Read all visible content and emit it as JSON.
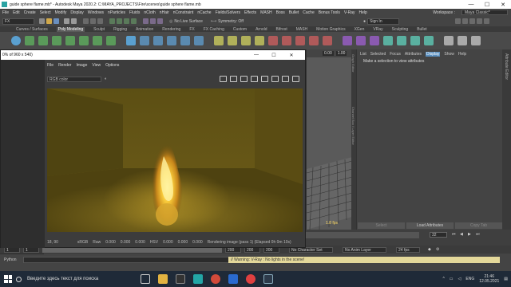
{
  "app": {
    "title": "guide sphere flame.mb* - Autodesk Maya 2020.2: C:\\MAYA_PROJECTS\\Fire\\scenes\\guide sphere flame.mb",
    "window_controls": [
      "—",
      "☐",
      "✕"
    ]
  },
  "menubar": {
    "items": [
      "File",
      "Edit",
      "Create",
      "Select",
      "Modify",
      "Display",
      "Windows",
      "nParticles",
      "Fluids",
      "nCloth",
      "nHair",
      "nConstraint",
      "nCache",
      "Fields/Solvers",
      "Effects",
      "MASH",
      "Boss",
      "Bullet",
      "Cache",
      "Bonus Tools",
      "V-Ray",
      "Help"
    ],
    "workspace_label": "Workspace :",
    "workspace_value": "Maya Classic*"
  },
  "toolbar": {
    "menuset": "FX",
    "no_live_surface": "No Live Surface",
    "symmetry": "Symmetry: Off",
    "sign_in": "Sign In"
  },
  "shelf_tabs": {
    "items": [
      "Curves / Surfaces",
      "Poly Modeling",
      "Sculpt",
      "Rigging",
      "Animation",
      "Rendering",
      "FX",
      "FX Caching",
      "Custom",
      "Arnold",
      "Bifrost",
      "MASH",
      "Motion Graphics",
      "XGen",
      "VRay",
      "Sculpting",
      "Bullet"
    ],
    "active_index": 1
  },
  "render_window": {
    "title": "0% of 960 x 540)",
    "menu": [
      "File",
      "Render",
      "Image",
      "View",
      "Options"
    ],
    "channel": "RGB color",
    "status_coords": "18, 90",
    "status_items": [
      "sRGB",
      "Raw",
      "0.000",
      "0.000",
      "0.000",
      "HSV",
      "0.000",
      "0.000",
      "0.000"
    ],
    "status_msg": "Rendering image (pass 1) (Elapsed 0h 0m 10s)",
    "close_glyph": "✕"
  },
  "viewport": {
    "fps": "1.8 fps",
    "coord": "0.00",
    "value": "1.00"
  },
  "attribute_editor": {
    "menu": [
      "List",
      "Selected",
      "Focus",
      "Attributes",
      "Display",
      "Show",
      "Help"
    ],
    "highlight_index": 4,
    "message": "Make a selection to view attributes",
    "buttons": [
      "Select",
      "Load Attributes",
      "Copy Tab"
    ],
    "side_label": "Attribute Editor",
    "channel_label": "Channel Box / Layer Editor",
    "graph_label": "Graph Editor"
  },
  "timeline": {
    "current_frame": "32"
  },
  "range": {
    "start": "1",
    "inner_start": "1",
    "end_inner": "200",
    "end": "200",
    "end2": "200",
    "character_set": "No Character Set",
    "anim_layer": "No Anim Layer",
    "fps": "24 fps"
  },
  "command": {
    "label": "Python",
    "warning": "// Warning: V-Ray : No lights in the scene!"
  },
  "taskbar": {
    "search_placeholder": "Введите здесь текст для поиска",
    "lang": "ENG",
    "time": "21:46",
    "date": "12.05.2021"
  }
}
